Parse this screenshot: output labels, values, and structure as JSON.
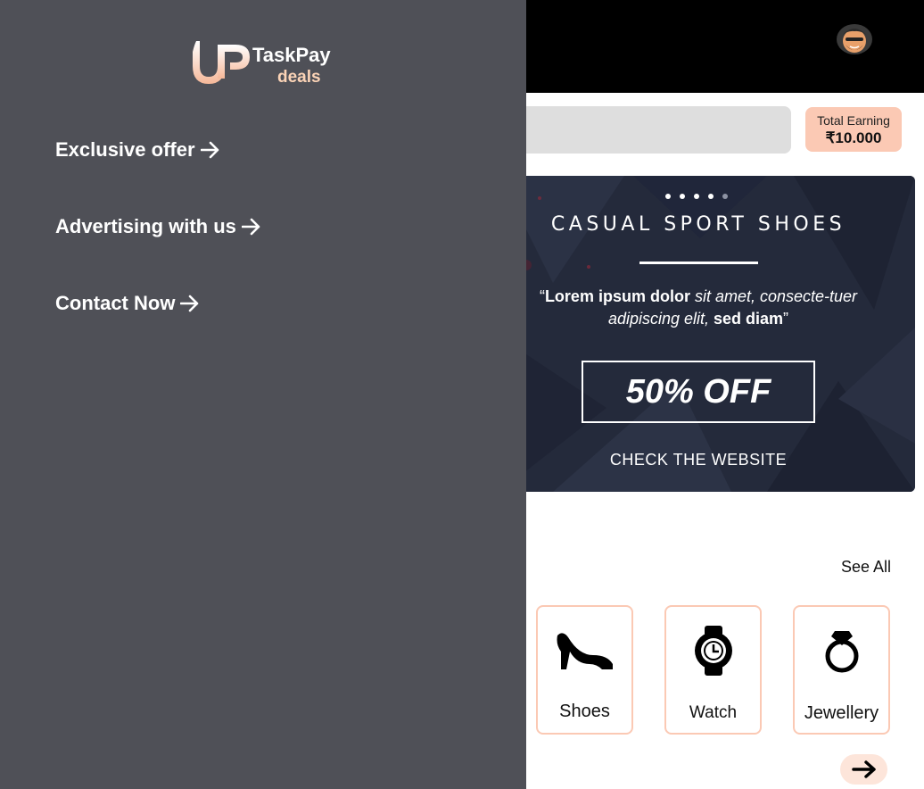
{
  "drawer": {
    "logo": {
      "brand": "TaskPay",
      "sub": "deals"
    },
    "menu": [
      {
        "label": "Exclusive offer"
      },
      {
        "label": "Advertising with us"
      },
      {
        "label": "Contact Now"
      }
    ]
  },
  "header": {
    "avatar_icon": "user-avatar"
  },
  "earning": {
    "label": "Total Earning",
    "value": "₹10.000"
  },
  "banner": {
    "title": "CASUAL SPORT SHOES",
    "quote_bold1": "Lorem ipsum dolor",
    "quote_italic": "sit amet, consecte-tuer adipiscing elit,",
    "quote_bold2": "sed diam",
    "offer": "50% OFF",
    "cta": "CHECK THE WEBSITE",
    "slides": 5,
    "active_slide": 1
  },
  "categories": {
    "see_all": "See All",
    "items": [
      {
        "name": "Shoes",
        "icon": "high-heel-icon"
      },
      {
        "name": "Watch",
        "icon": "watch-icon"
      },
      {
        "name": "Jewellery",
        "icon": "ring-icon"
      }
    ]
  },
  "colors": {
    "drawer_bg": "#4f5057",
    "accent": "#fbc9b4",
    "topbar": "#000000",
    "logo_sub": "#fbd3b6"
  }
}
